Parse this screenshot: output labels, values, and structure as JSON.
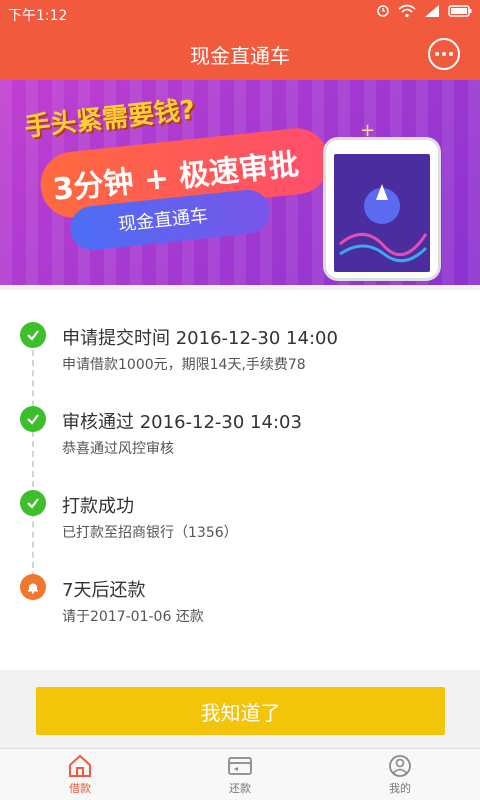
{
  "status_bar": {
    "time": "下午1:12"
  },
  "header": {
    "title": "现金直通车",
    "more_icon": "more-icon"
  },
  "banner": {
    "question": "手头紧需要钱?",
    "slogan": "3分钟 + 极速审批",
    "brand": "现金直通车",
    "slides_count": 2,
    "active_slide": 1
  },
  "timeline": {
    "steps": [
      {
        "title": "申请提交时间   2016-12-30 14:00",
        "sub": "申请借款1000元，期限14天,手续费78",
        "status": "done"
      },
      {
        "title": "审核通过   2016-12-30 14:03",
        "sub": "恭喜通过风控审核",
        "status": "done"
      },
      {
        "title": "打款成功",
        "sub": "已打款至招商银行（1356）",
        "status": "done"
      },
      {
        "title": "7天后还款",
        "sub": "请于2017-01-06 还款",
        "status": "pending"
      }
    ]
  },
  "confirm_button": {
    "label": "我知道了"
  },
  "tabbar": {
    "tabs": [
      {
        "label": "借款",
        "icon": "home-icon",
        "active": true
      },
      {
        "label": "还款",
        "icon": "card-icon",
        "active": false
      },
      {
        "label": "我的",
        "icon": "profile-icon",
        "active": false
      }
    ]
  },
  "colors": {
    "primary": "#f15a3c",
    "success": "#3cbf2a",
    "warning": "#f0782e",
    "button": "#f2c40a"
  }
}
